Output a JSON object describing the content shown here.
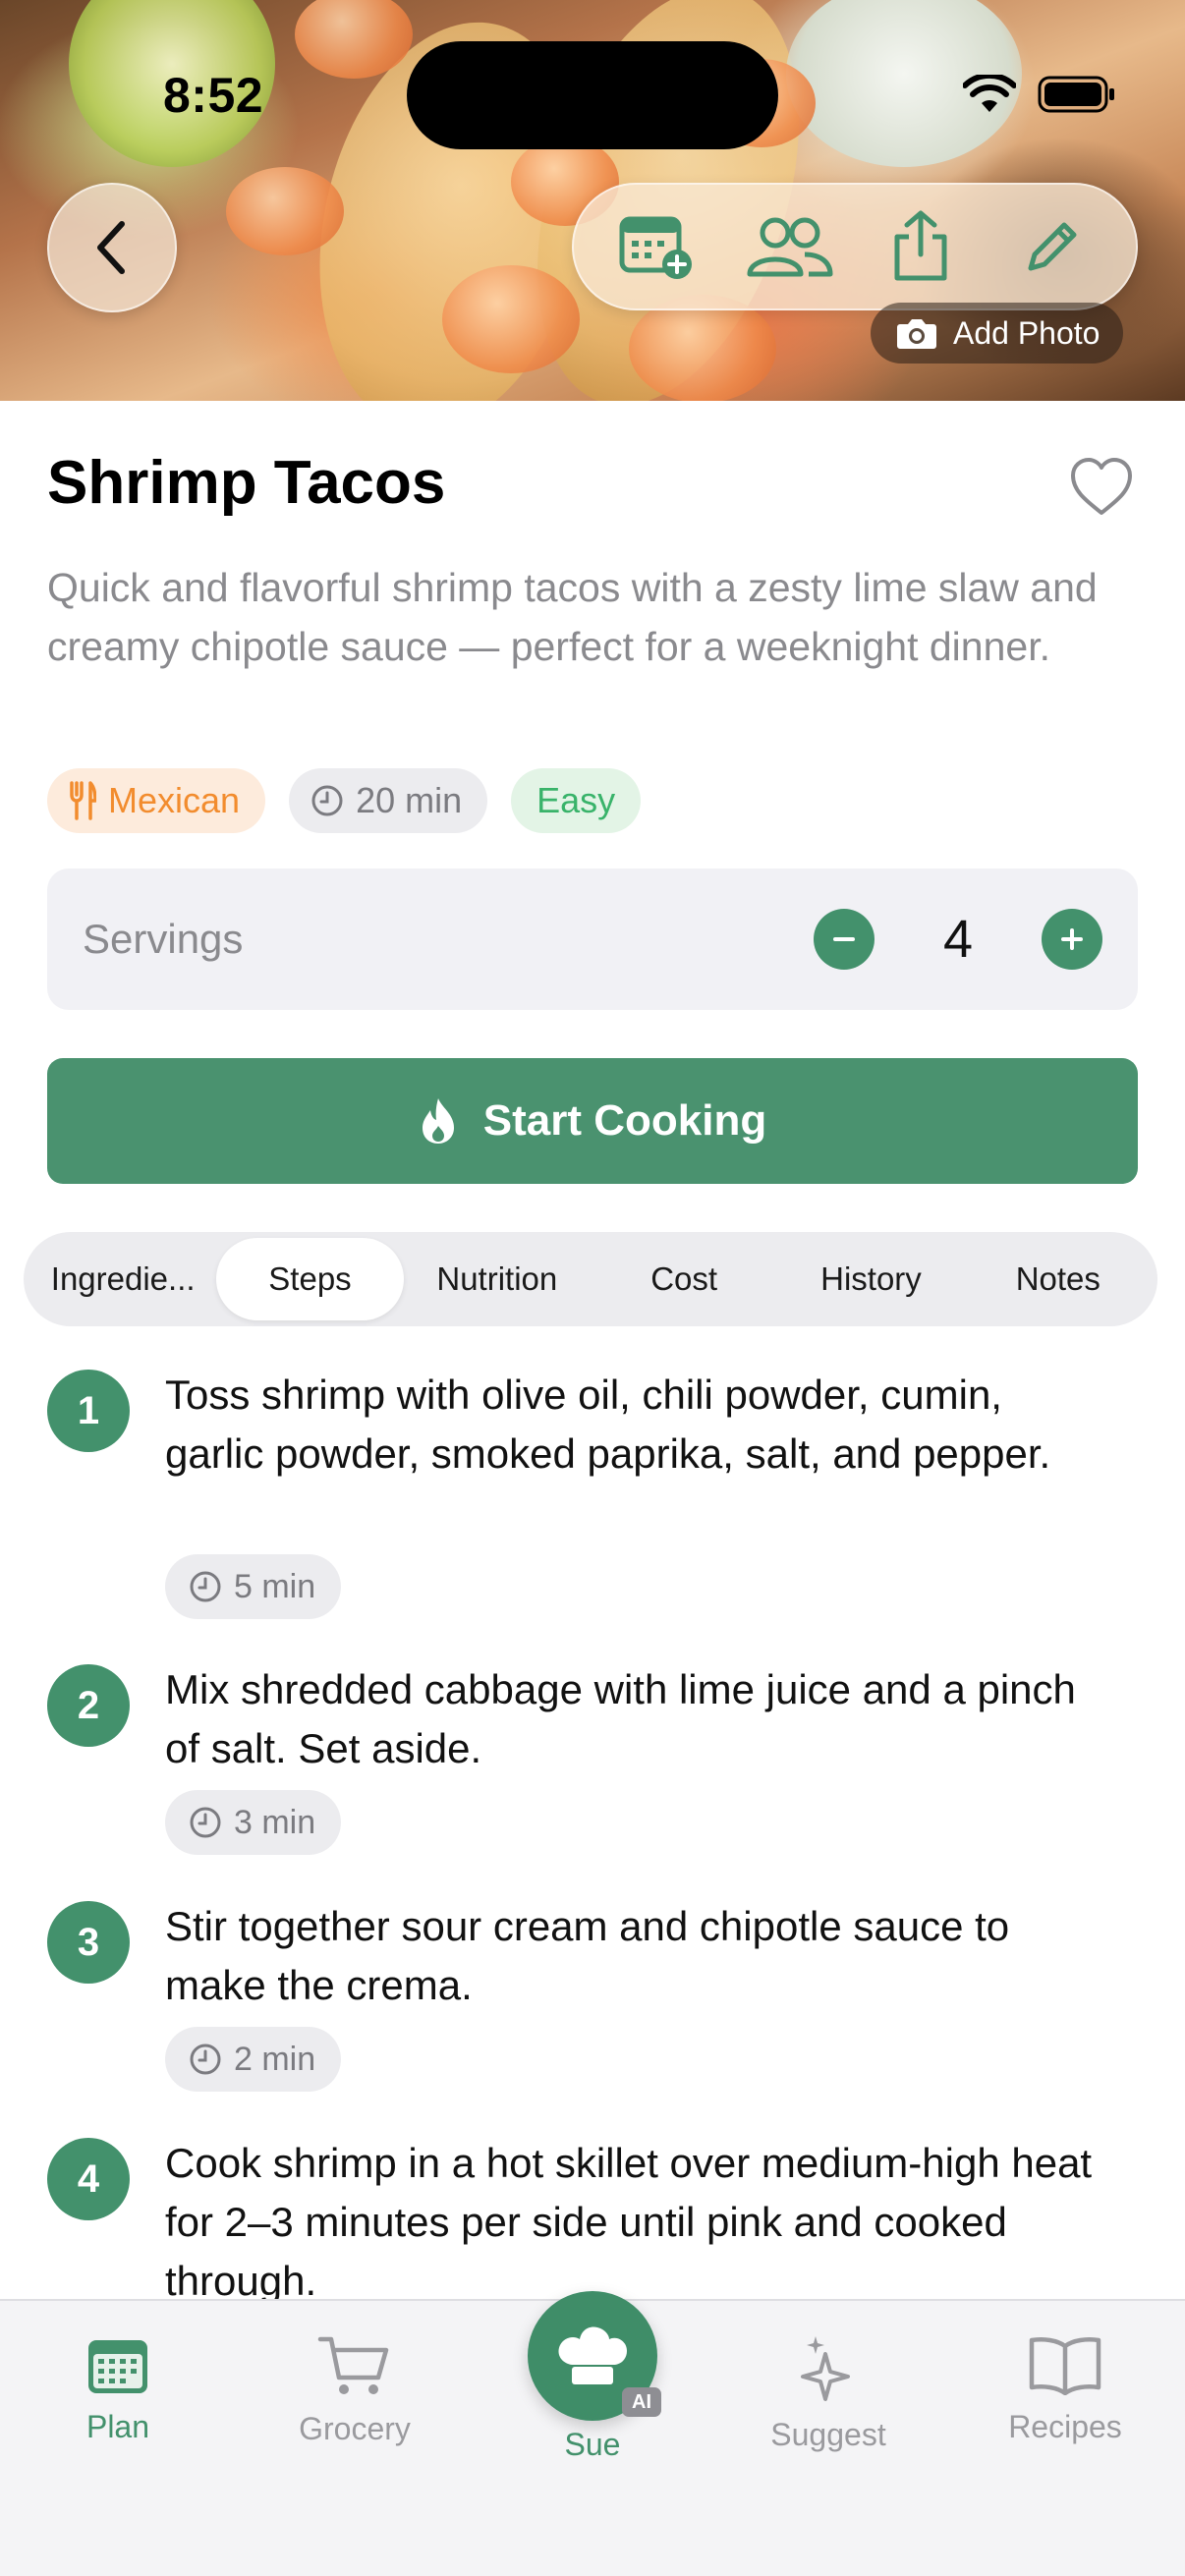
{
  "status_bar": {
    "time": "8:52"
  },
  "hero": {
    "add_photo_label": "Add Photo"
  },
  "recipe": {
    "title": "Shrimp Tacos",
    "description": "Quick and flavorful shrimp tacos with a zesty lime slaw and creamy chipotle sauce — perfect for a weeknight dinner.",
    "tags": {
      "cuisine": "Mexican",
      "time": "20 min",
      "difficulty": "Easy"
    }
  },
  "servings": {
    "label": "Servings",
    "value": "4"
  },
  "start_cooking_label": "Start Cooking",
  "tabs": [
    {
      "label": "Ingredie..."
    },
    {
      "label": "Steps"
    },
    {
      "label": "Nutrition"
    },
    {
      "label": "Cost"
    },
    {
      "label": "History"
    },
    {
      "label": "Notes"
    }
  ],
  "active_tab": "Steps",
  "steps": [
    {
      "num": "1",
      "text": "Toss shrimp with olive oil, chili powder, cumin, garlic powder, smoked paprika, salt, and pepper.",
      "time": "5 min"
    },
    {
      "num": "2",
      "text": "Mix shredded cabbage with lime juice and a pinch of salt. Set aside.",
      "time": "3 min"
    },
    {
      "num": "3",
      "text": "Stir together sour cream and chipotle sauce to make the crema.",
      "time": "2 min"
    },
    {
      "num": "4",
      "text": "Cook shrimp in a hot skillet over medium-high heat for 2–3 minutes per side until pink and cooked through.",
      "time": ""
    }
  ],
  "tabbar": {
    "plan": "Plan",
    "grocery": "Grocery",
    "sue": "Sue",
    "ai_badge": "AI",
    "suggest": "Suggest",
    "recipes": "Recipes"
  },
  "colors": {
    "accent": "#43916c",
    "cuisine_tag": "#f28c2e",
    "easy_tag": "#39b36a"
  }
}
